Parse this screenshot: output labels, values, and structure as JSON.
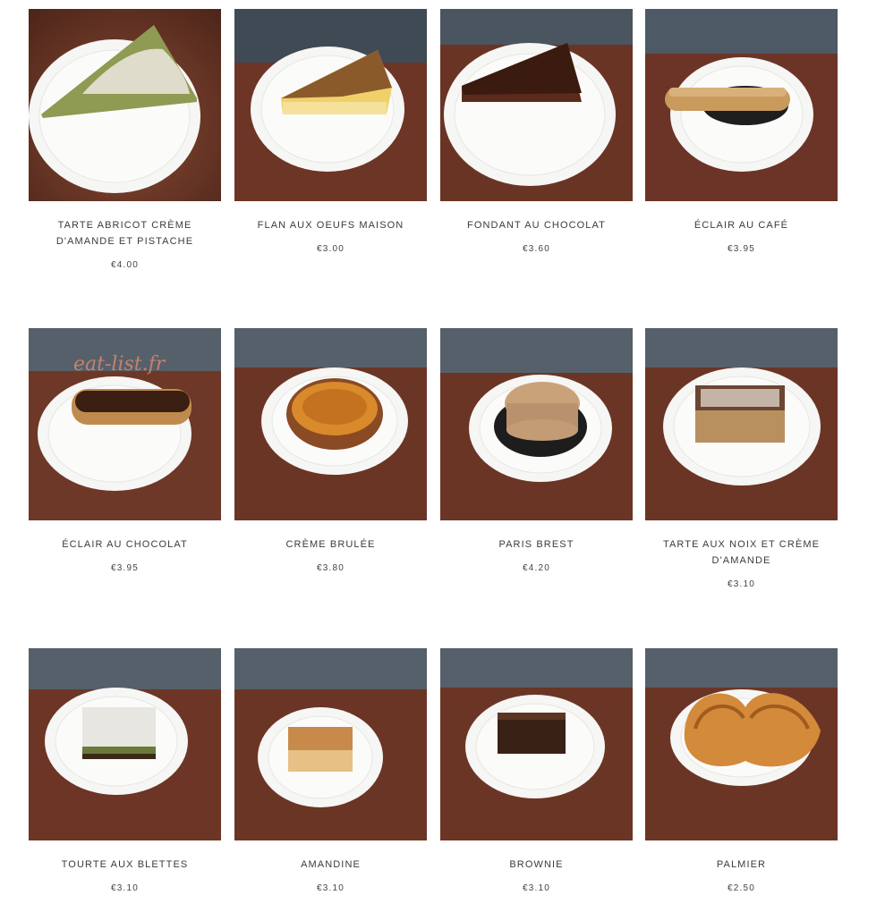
{
  "products": [
    {
      "name": "TARTE ABRICOT CRÈME D'AMANDE ET PISTACHE",
      "price": "€4.00",
      "kind": "tart-slice-pistachio"
    },
    {
      "name": "FLAN AUX OEUFS MAISON",
      "price": "€3.00",
      "kind": "flan-slice"
    },
    {
      "name": "FONDANT AU CHOCOLAT",
      "price": "€3.60",
      "kind": "chocolate-slice"
    },
    {
      "name": "ÉCLAIR AU CAFÉ",
      "price": "€3.95",
      "kind": "eclair-coffee"
    },
    {
      "name": "ÉCLAIR AU CHOCOLAT",
      "price": "€3.95",
      "kind": "eclair-chocolate"
    },
    {
      "name": "CRÈME BRULÉE",
      "price": "€3.80",
      "kind": "creme-brulee"
    },
    {
      "name": "PARIS BREST",
      "price": "€4.20",
      "kind": "paris-brest"
    },
    {
      "name": "TARTE AUX NOIX ET CRÈME D'AMANDE",
      "price": "€3.10",
      "kind": "walnut-square"
    },
    {
      "name": "TOURTE AUX BLETTES",
      "price": "€3.10",
      "kind": "tourte-square"
    },
    {
      "name": "AMANDINE",
      "price": "€3.10",
      "kind": "amandine-square"
    },
    {
      "name": "BROWNIE",
      "price": "€3.10",
      "kind": "brownie-square"
    },
    {
      "name": "PALMIER",
      "price": "€2.50",
      "kind": "palmier"
    }
  ],
  "watermark": "eat-list.fr",
  "colors": {
    "counter": "#6b3325",
    "plate": "#f7f7f5",
    "text": "#3b3b3b"
  }
}
